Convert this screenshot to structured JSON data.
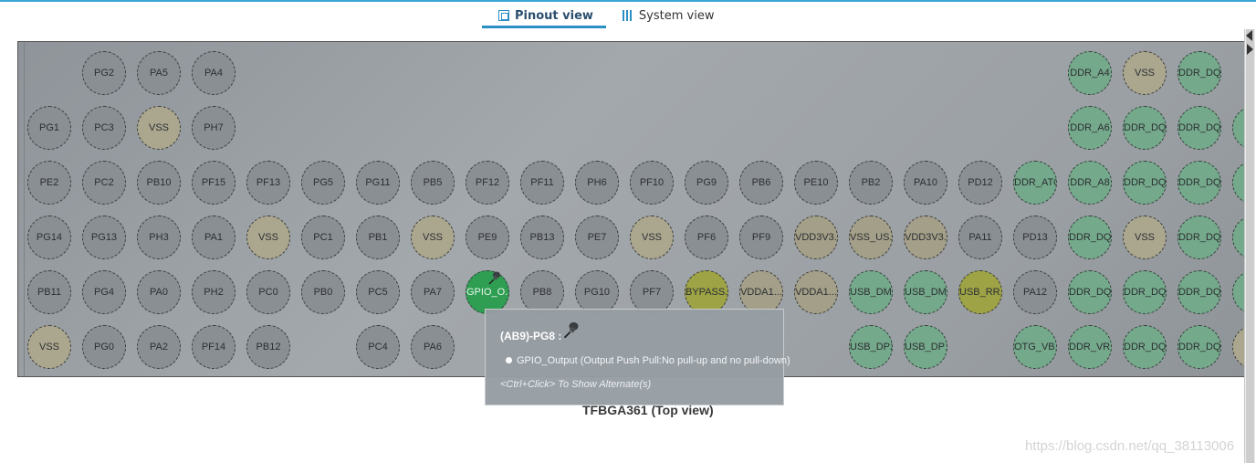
{
  "tabs": [
    {
      "label": "Pinout view",
      "icon": "chip-icon",
      "active": true
    },
    {
      "label": "System view",
      "icon": "grid-icon",
      "active": false
    }
  ],
  "pins": [
    [
      {
        "label": ""
      },
      {
        "label": "PG2"
      },
      {
        "label": "PA5"
      },
      {
        "label": "PA4"
      },
      {
        "label": ""
      },
      {
        "label": ""
      },
      {
        "label": ""
      },
      {
        "label": ""
      },
      {
        "label": ""
      },
      {
        "label": ""
      },
      {
        "label": ""
      },
      {
        "label": ""
      },
      {
        "label": ""
      },
      {
        "label": ""
      },
      {
        "label": ""
      },
      {
        "label": ""
      },
      {
        "label": ""
      },
      {
        "label": ""
      },
      {
        "label": ""
      },
      {
        "label": "DDR_A4",
        "kind": "ddr"
      },
      {
        "label": "VSS",
        "kind": "vss"
      },
      {
        "label": "DDR_DQ...",
        "kind": "ddr"
      },
      {
        "label": ""
      }
    ],
    [
      {
        "label": "PG1"
      },
      {
        "label": "PC3"
      },
      {
        "label": "VSS",
        "kind": "vss"
      },
      {
        "label": "PH7"
      },
      {
        "label": ""
      },
      {
        "label": ""
      },
      {
        "label": ""
      },
      {
        "label": ""
      },
      {
        "label": ""
      },
      {
        "label": ""
      },
      {
        "label": ""
      },
      {
        "label": ""
      },
      {
        "label": ""
      },
      {
        "label": ""
      },
      {
        "label": ""
      },
      {
        "label": ""
      },
      {
        "label": ""
      },
      {
        "label": ""
      },
      {
        "label": ""
      },
      {
        "label": "DDR_A6",
        "kind": "ddr"
      },
      {
        "label": "DDR_DQ...",
        "kind": "ddr"
      },
      {
        "label": "DDR_DQ...",
        "kind": "ddr"
      },
      {
        "label": "DD",
        "kind": "ddr"
      }
    ],
    [
      {
        "label": "PE2"
      },
      {
        "label": "PC2"
      },
      {
        "label": "PB10"
      },
      {
        "label": "PF15"
      },
      {
        "label": "PF13"
      },
      {
        "label": "PG5"
      },
      {
        "label": "PG11"
      },
      {
        "label": "PB5"
      },
      {
        "label": "PF12"
      },
      {
        "label": "PF11"
      },
      {
        "label": "PH6"
      },
      {
        "label": "PF10"
      },
      {
        "label": "PG9"
      },
      {
        "label": "PB6"
      },
      {
        "label": "PE10"
      },
      {
        "label": "PB2"
      },
      {
        "label": "PA10"
      },
      {
        "label": "PD12"
      },
      {
        "label": "DDR_ATO",
        "kind": "ddr"
      },
      {
        "label": "DDR_A8",
        "kind": "ddr"
      },
      {
        "label": "DDR_DQ...",
        "kind": "ddr"
      },
      {
        "label": "DDR_DQ...",
        "kind": "ddr"
      },
      {
        "label": "DD",
        "kind": "ddr"
      }
    ],
    [
      {
        "label": "PG14"
      },
      {
        "label": "PG13"
      },
      {
        "label": "PH3"
      },
      {
        "label": "PA1"
      },
      {
        "label": "VSS",
        "kind": "vss"
      },
      {
        "label": "PC1"
      },
      {
        "label": "PB1"
      },
      {
        "label": "VSS",
        "kind": "vss"
      },
      {
        "label": "PE9"
      },
      {
        "label": "PB13"
      },
      {
        "label": "PE7"
      },
      {
        "label": "VSS",
        "kind": "vss"
      },
      {
        "label": "PF6"
      },
      {
        "label": "PF9"
      },
      {
        "label": "VDD3V3...",
        "kind": "vdda"
      },
      {
        "label": "VSS_US...",
        "kind": "vdda"
      },
      {
        "label": "VDD3V3...",
        "kind": "vdda"
      },
      {
        "label": "PA11"
      },
      {
        "label": "PD13"
      },
      {
        "label": "DDR_DQ...",
        "kind": "ddr"
      },
      {
        "label": "VSS",
        "kind": "vss"
      },
      {
        "label": "DDR_DQ...",
        "kind": "ddr"
      },
      {
        "label": "DD",
        "kind": "ddr"
      }
    ],
    [
      {
        "label": "PB11"
      },
      {
        "label": "PG4"
      },
      {
        "label": "PA0"
      },
      {
        "label": "PH2"
      },
      {
        "label": "PC0"
      },
      {
        "label": "PB0"
      },
      {
        "label": "PC5"
      },
      {
        "label": "PA7"
      },
      {
        "label": "GPIO_O...",
        "kind": "gpio"
      },
      {
        "label": "PB8"
      },
      {
        "label": "PG10"
      },
      {
        "label": "PF7"
      },
      {
        "label": "BYPASS...",
        "kind": "byp"
      },
      {
        "label": "VDDA1...",
        "kind": "vdda"
      },
      {
        "label": "VDDA1...",
        "kind": "vdda"
      },
      {
        "label": "USB_DM2",
        "kind": "ddr"
      },
      {
        "label": "USB_DM1",
        "kind": "ddr"
      },
      {
        "label": "USB_RR...",
        "kind": "byp"
      },
      {
        "label": "PA12"
      },
      {
        "label": "DDR_DQ...",
        "kind": "ddr"
      },
      {
        "label": "DDR_DQ...",
        "kind": "ddr"
      },
      {
        "label": "DDR_DQ...",
        "kind": "ddr"
      },
      {
        "label": "DD",
        "kind": "ddr"
      }
    ],
    [
      {
        "label": "VSS",
        "kind": "vss"
      },
      {
        "label": "PG0"
      },
      {
        "label": "PA2"
      },
      {
        "label": "PF14"
      },
      {
        "label": "PB12"
      },
      {
        "label": ""
      },
      {
        "label": "PC4"
      },
      {
        "label": "PA6"
      },
      {
        "label": ""
      },
      {
        "label": ""
      },
      {
        "label": ""
      },
      {
        "label": ""
      },
      {
        "label": ""
      },
      {
        "label": ""
      },
      {
        "label": ""
      },
      {
        "label": "USB_DP2",
        "kind": "ddr"
      },
      {
        "label": "USB_DP1",
        "kind": "ddr"
      },
      {
        "label": ""
      },
      {
        "label": "OTG_VB...",
        "kind": "ddr"
      },
      {
        "label": "DDR_VR...",
        "kind": "ddr"
      },
      {
        "label": "DDR_DQ...",
        "kind": "ddr"
      },
      {
        "label": "DDR_DQ...",
        "kind": "ddr"
      },
      {
        "label": "V",
        "kind": "vss"
      }
    ]
  ],
  "tooltip": {
    "title": "(AB9)-PG8 :",
    "line": "GPIO_Output (Output Push Pull:No pull-up and no pull-down)",
    "hint": "<Ctrl+Click> To Show Alternate(s)"
  },
  "caption": "TFBGA361 (Top view)",
  "watermark": "https://blog.csdn.net/qq_38113006",
  "colors": {
    "accent": "#2b8fc4",
    "gpio": "#2f9e53",
    "ddr": "#75a98b",
    "vss": "#aba68e",
    "bypass": "#9ea345",
    "pin": "#8a8f94"
  }
}
